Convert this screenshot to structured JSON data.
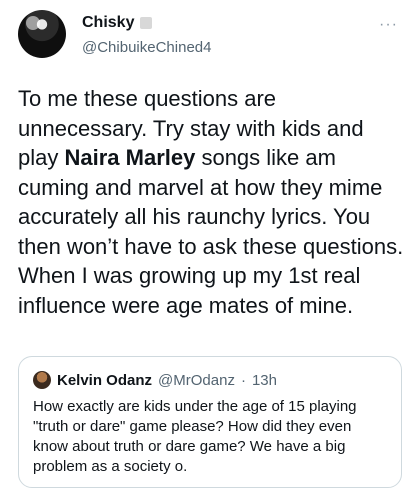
{
  "tweet": {
    "display_name": "Chisky",
    "handle": "@ChibuikeChined4",
    "more_label": "···",
    "text_before": "To me these questions are unnecessary. Try stay with kids and play ",
    "text_bold": "Naira Marley",
    "text_after": " songs like am cuming and marvel at how they mime accurately all his raunchy lyrics. You then won’t have to ask these questions. When I was growing up my 1st real influence were age mates of mine."
  },
  "quoted": {
    "display_name": "Kelvin Odanz",
    "handle": "@MrOdanz",
    "separator": "·",
    "time": "13h",
    "text": "How exactly are kids under the age of 15 playing \"truth or dare\" game please? How did they even know about truth or dare game?  We have a big problem as a society o."
  }
}
